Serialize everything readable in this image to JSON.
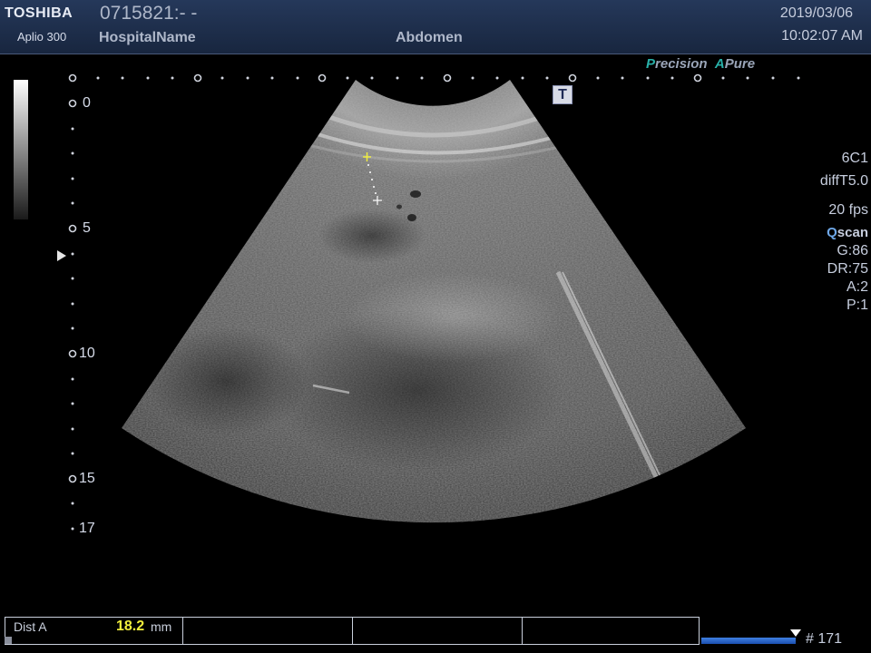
{
  "header": {
    "brand": "TOSHIBA",
    "model": "Aplio 300",
    "patient_id": "0715821:- -",
    "hospital": "HospitalName",
    "exam": "Abdomen",
    "date": "2019/03/06",
    "time": "10:02:07 AM"
  },
  "modes": {
    "p_letter": "P",
    "precision_rest": "recision",
    "a_letter": "A",
    "pure_rest": "Pure"
  },
  "t_marker": "T",
  "params": {
    "probe": "6C1",
    "preset": "diffT5.0",
    "fps": "20 fps",
    "qscan_q": "Q",
    "qscan_rest": "scan",
    "gain": "G:86",
    "dr": "DR:75",
    "a": "A:2",
    "p": "P:1"
  },
  "depth_scale": {
    "d0": "0",
    "d5": "5",
    "d10": "10",
    "d15": "15",
    "d17": "17"
  },
  "measurement": {
    "label": "Dist A",
    "value": "18.2",
    "unit": "mm"
  },
  "cine": {
    "frame_label": "# 171"
  },
  "colors": {
    "header_bg": "#1f3050",
    "measure_value": "#f2ef3c",
    "accent_teal": "#28b0a8"
  }
}
